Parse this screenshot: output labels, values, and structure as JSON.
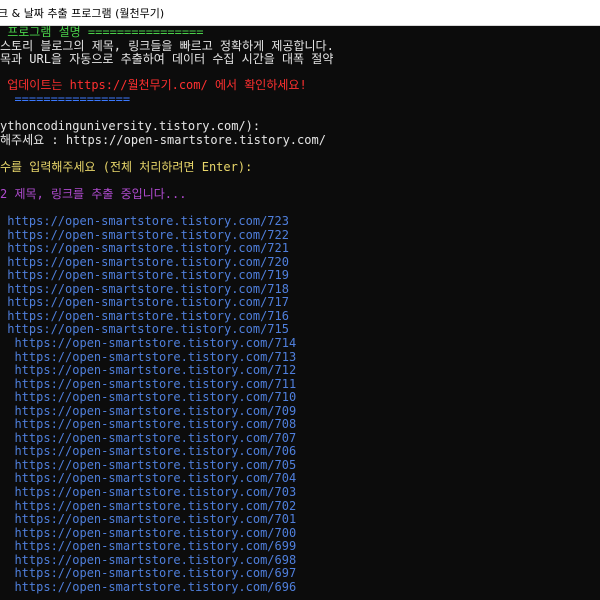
{
  "window": {
    "title": "크 & 날짜 추출 프로그램 (월천무기)"
  },
  "console": {
    "header_title": " 프로그램 설명 ================",
    "desc1": "스토리 블로그의 제목, 링크들을 빠르고 정확하게 제공합니다.",
    "desc2": "목과 URL을 자동으로 추출하여 데이터 수집 시간을 대폭 절약",
    "update_notice": " 업데이트는 https://월천무기.com/ 에서 확인하세요!",
    "divider": "  ================",
    "example_url": "ythoncodinguniversity.tistory.com/):",
    "input_prompt": "해주세요 : https://open-smartstore.tistory.com/",
    "count_prompt": "수를 입력해주세요 (전체 처리하려면 Enter):",
    "extracting": "2 제목, 링크를 추출 중입니다...",
    "links_a": [
      " https://open-smartstore.tistory.com/723",
      " https://open-smartstore.tistory.com/722",
      " https://open-smartstore.tistory.com/721",
      " https://open-smartstore.tistory.com/720",
      " https://open-smartstore.tistory.com/719",
      " https://open-smartstore.tistory.com/718",
      " https://open-smartstore.tistory.com/717",
      " https://open-smartstore.tistory.com/716",
      " https://open-smartstore.tistory.com/715"
    ],
    "links_b": [
      "  https://open-smartstore.tistory.com/714",
      "  https://open-smartstore.tistory.com/713",
      "  https://open-smartstore.tistory.com/712",
      "  https://open-smartstore.tistory.com/711",
      "  https://open-smartstore.tistory.com/710",
      "  https://open-smartstore.tistory.com/709",
      "  https://open-smartstore.tistory.com/708",
      "  https://open-smartstore.tistory.com/707",
      "  https://open-smartstore.tistory.com/706",
      "  https://open-smartstore.tistory.com/705",
      "  https://open-smartstore.tistory.com/704",
      "  https://open-smartstore.tistory.com/703",
      "  https://open-smartstore.tistory.com/702",
      "  https://open-smartstore.tistory.com/701",
      "  https://open-smartstore.tistory.com/700",
      "  https://open-smartstore.tistory.com/699",
      "  https://open-smartstore.tistory.com/698",
      "  https://open-smartstore.tistory.com/697",
      "  https://open-smartstore.tistory.com/696"
    ]
  }
}
